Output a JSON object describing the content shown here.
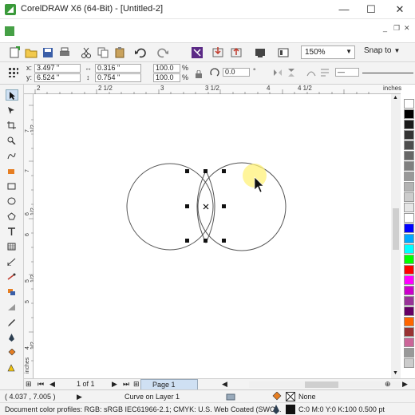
{
  "window": {
    "title": "CorelDRAW X6 (64-Bit) - [Untitled-2]",
    "minimize": "—",
    "maximize": "☐",
    "close": "✕"
  },
  "document_controls": {
    "minimize": "_",
    "restore": "❐",
    "close": "✕"
  },
  "toolbar": {
    "zoom_value": "150%",
    "snap_label": "Snap to",
    "icons": [
      "new-icon",
      "open-icon",
      "save-icon",
      "print-icon",
      "cut-icon",
      "copy-icon",
      "paste-icon",
      "undo-icon",
      "redo-icon",
      "search-content-icon",
      "import-icon",
      "export-icon",
      "publish-pdf-icon",
      "app-launcher-icon"
    ]
  },
  "property_bar": {
    "x_label": "x:",
    "x_value": "3.497 \"",
    "y_label": "y:",
    "y_value": "6.524 \"",
    "width_value": "0.316 \"",
    "height_value": "0.754 \"",
    "scale_w": "100.0",
    "scale_h": "100.0",
    "percent": "%",
    "rotation": "0.0",
    "degree": "°",
    "outline_width": "—"
  },
  "ruler": {
    "unit": "inches",
    "h_ticks": [
      "2",
      "2 1/2",
      "3",
      "3 1/2",
      "4",
      "4 1/2"
    ],
    "v_ticks": [
      "7 1/2",
      "7",
      "6 1/2",
      "6",
      "5 1/2",
      "5",
      "4 1/2",
      "4"
    ],
    "v_unit": "inches"
  },
  "page_nav": {
    "page_count": "1 of 1",
    "page_tab": "Page 1"
  },
  "status": {
    "cursor_position": "( 4.037 , 7.005 )",
    "object_info": "Curve on Layer 1",
    "fill_label": "None",
    "color_profiles": "Document color profiles: RGB: sRGB IEC61966-2.1; CMYK: U.S. Web Coated (SWO...",
    "outline_info": "C:0 M:0 Y:0 K:100  0.500 pt"
  },
  "palette_colors": [
    "#ffffff",
    "#000000",
    "#1a1a1a",
    "#333333",
    "#4d4d4d",
    "#666666",
    "#808080",
    "#999999",
    "#b3b3b3",
    "#cccccc",
    "#e6e6e6",
    "#ffffff",
    "#0000ff",
    "#00aaff",
    "#00ffff",
    "#00ff00",
    "#ff0000",
    "#ff00ff",
    "#cc00cc",
    "#993399",
    "#660066",
    "#ff6600",
    "#993333",
    "#cc6699",
    "#999999",
    "#cccccc"
  ],
  "tools": [
    "pick-tool-icon",
    "shape-tool-icon",
    "crop-tool-icon",
    "zoom-tool-icon",
    "freehand-tool-icon",
    "smart-fill-icon",
    "rectangle-tool-icon",
    "ellipse-tool-icon",
    "polygon-tool-icon",
    "text-tool-icon",
    "table-tool-icon",
    "dimension-tool-icon",
    "connector-tool-icon",
    "effects-tool-icon",
    "transparency-tool-icon",
    "eyedropper-tool-icon",
    "outline-pen-icon",
    "fill-tool-icon",
    "interactive-fill-icon"
  ]
}
